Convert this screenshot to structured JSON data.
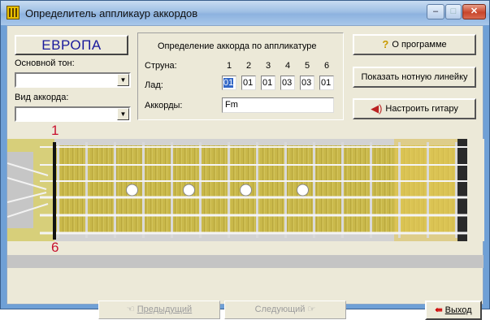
{
  "window": {
    "title": "Определитель аппликаур аккордов"
  },
  "controls": {
    "minimize": "–",
    "maximize": "□",
    "close": "✕"
  },
  "left": {
    "region_button": "ЕВРОПА",
    "root_label": "Основной тон:",
    "root_value": "",
    "chord_type_label": "Вид аккорда:",
    "chord_type_value": ""
  },
  "group": {
    "title": "Определение аккорда по аппликатуре",
    "string_label": "Струна:",
    "fret_label": "Лад:",
    "chords_label": "Аккорды:",
    "strings": [
      "1",
      "2",
      "3",
      "4",
      "5",
      "6"
    ],
    "frets": [
      "01",
      "01",
      "01",
      "03",
      "03",
      "01"
    ],
    "chord_result": "Fm"
  },
  "buttons": {
    "about": "О программе",
    "notation": "Показать нотную линейку",
    "tune": "Настроить гитару",
    "prev": "Предыдущий",
    "next": "Следующий",
    "exit": "Выход"
  },
  "fretboard": {
    "top_marker": "1",
    "bottom_marker": "6",
    "barre_fret": 1,
    "inlay_frets": [
      3,
      5,
      7,
      9
    ],
    "colors": {
      "wood": "#c9b84a",
      "string": "#f4f4f4",
      "barre": "#111111"
    }
  },
  "icons": {
    "about": "help-icon",
    "tune": "speaker-icon",
    "prev": "hand-left-icon",
    "next": "hand-right-icon",
    "exit": "exit-door-icon"
  }
}
